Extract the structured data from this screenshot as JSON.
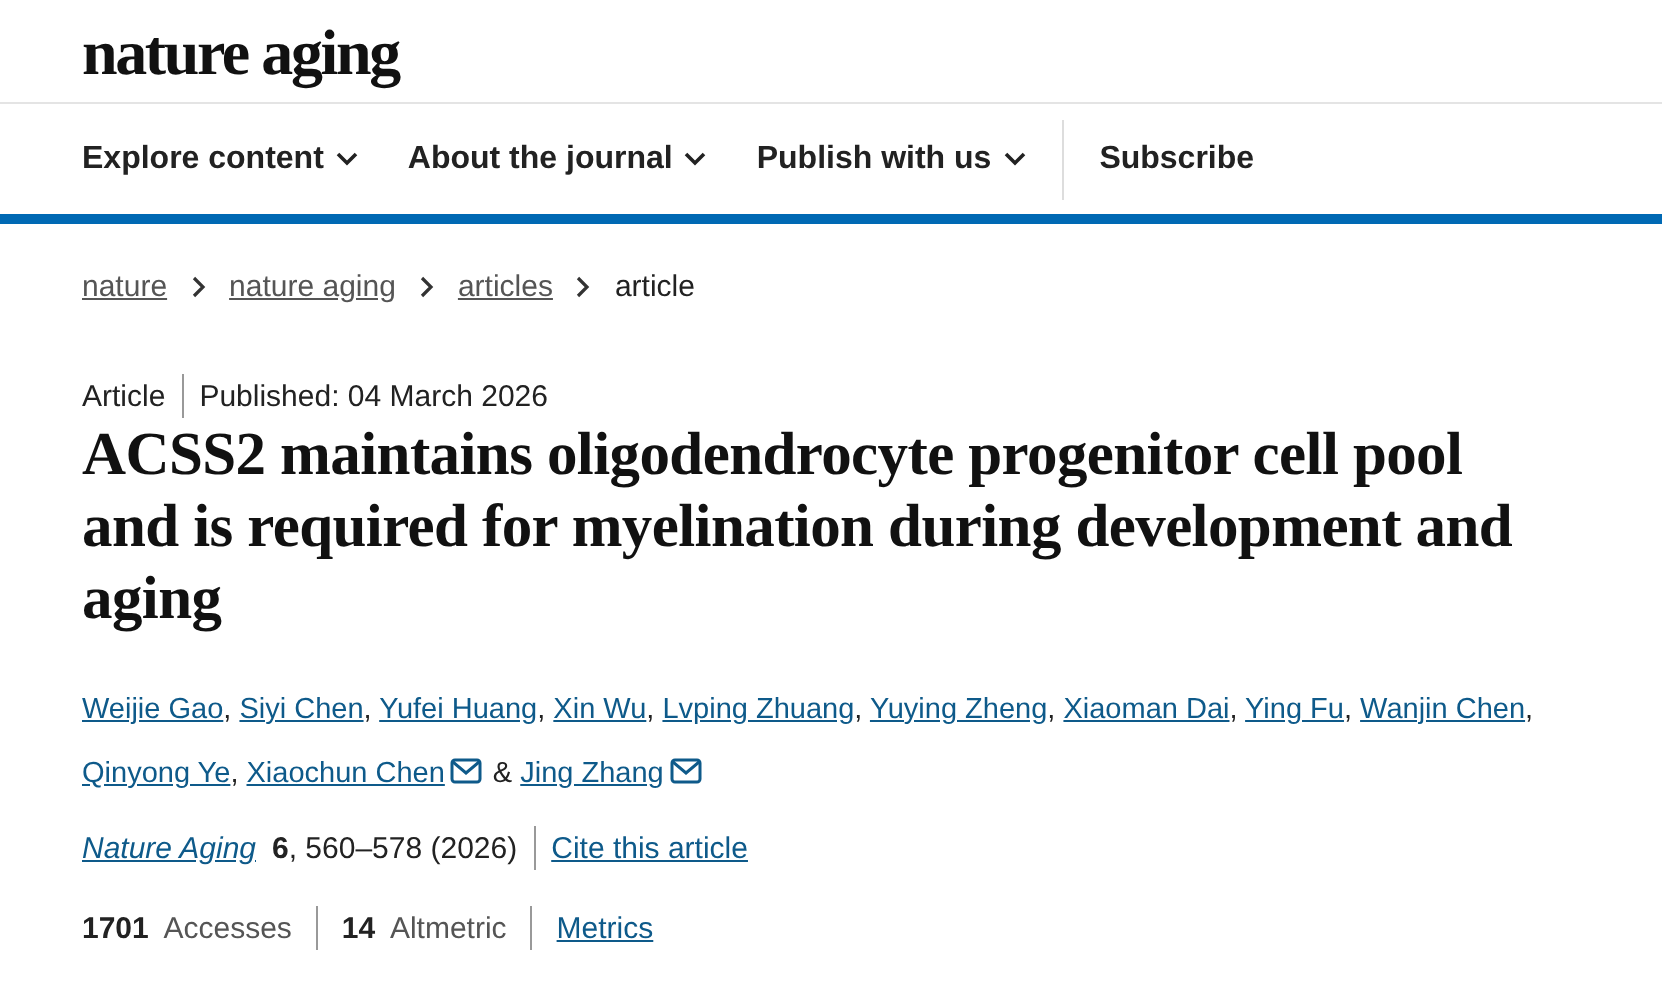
{
  "logo": "nature aging",
  "nav": [
    {
      "label": "Explore content",
      "dropdown": true
    },
    {
      "label": "About the journal",
      "dropdown": true
    },
    {
      "label": "Publish with us",
      "dropdown": true
    },
    {
      "label": "Subscribe",
      "dropdown": false
    }
  ],
  "breadcrumbs": [
    {
      "label": "nature",
      "link": true
    },
    {
      "label": "nature aging",
      "link": true
    },
    {
      "label": "articles",
      "link": true
    },
    {
      "label": "article",
      "link": false
    }
  ],
  "article_type": "Article",
  "published": "Published: 04 March 2026",
  "title": "ACSS2 maintains oligodendrocyte progenitor cell pool and is required for myelination during development and aging",
  "authors": [
    {
      "name": "Weijie Gao",
      "email": false,
      "separator": ","
    },
    {
      "name": "Siyi Chen",
      "email": false,
      "separator": ","
    },
    {
      "name": "Yufei Huang",
      "email": false,
      "separator": ","
    },
    {
      "name": "Xin Wu",
      "email": false,
      "separator": ","
    },
    {
      "name": "Lvping Zhuang",
      "email": false,
      "separator": ","
    },
    {
      "name": "Yuying Zheng",
      "email": false,
      "separator": ","
    },
    {
      "name": "Xiaoman Dai",
      "email": false,
      "separator": ","
    },
    {
      "name": "Ying Fu",
      "email": false,
      "separator": ","
    },
    {
      "name": "Wanjin Chen",
      "email": false,
      "separator": ","
    },
    {
      "name": "Qinyong Ye",
      "email": false,
      "separator": ","
    },
    {
      "name": "Xiaochun Chen",
      "email": true,
      "separator": "&"
    },
    {
      "name": "Jing Zhang",
      "email": true
    }
  ],
  "journal": "Nature Aging",
  "citation": "**6**, 560–578 (2026)",
  "cite_link": "Cite this article",
  "metrics": [
    {
      "count": "1701",
      "name": "Accesses"
    },
    {
      "count": "14",
      "name": "Altmetric"
    }
  ],
  "metrics_link": "Metrics"
}
